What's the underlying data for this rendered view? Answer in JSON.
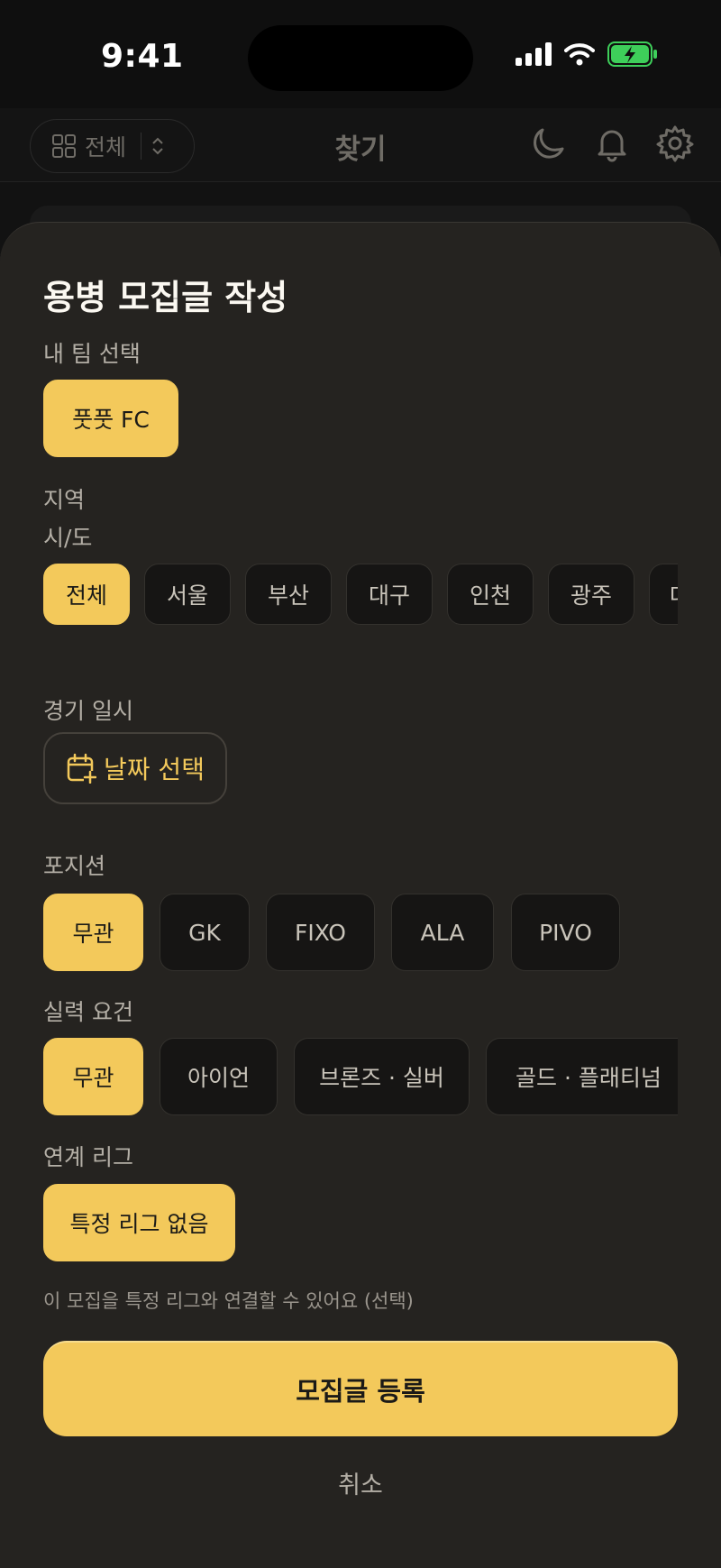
{
  "status_bar": {
    "time": "9:41"
  },
  "header": {
    "filter_label": "전체",
    "title": "찾기"
  },
  "sheet": {
    "title": "용병 모집글 작성",
    "team_section": {
      "label": "내 팀 선택",
      "selected_team": "풋풋 FC"
    },
    "region_section": {
      "label": "지역",
      "sublabel": "시/도",
      "options": [
        "전체",
        "서울",
        "부산",
        "대구",
        "인천",
        "광주",
        "대"
      ],
      "selected": "전체"
    },
    "date_section": {
      "label": "경기 일시",
      "button_label": "날짜 선택"
    },
    "position_section": {
      "label": "포지션",
      "options": [
        "무관",
        "GK",
        "FIXO",
        "ALA",
        "PIVO"
      ],
      "selected": "무관"
    },
    "skill_section": {
      "label": "실력 요건",
      "options": [
        "무관",
        "아이언",
        "브론즈 · 실버",
        "골드 · 플래티넘"
      ],
      "selected": "무관"
    },
    "league_section": {
      "label": "연계 리그",
      "selected_league": "특정 리그 없음",
      "helper": "이 모집을 특정 리그와 연결할 수 있어요 (선택)"
    },
    "submit_label": "모집글 등록",
    "cancel_label": "취소"
  },
  "colors": {
    "accent": "#f3c95b",
    "sheet_bg": "#252320",
    "chip_bg": "#161514"
  },
  "icons": [
    "grid-icon",
    "updown-icon",
    "moon-icon",
    "bell-icon",
    "gear-icon",
    "calendar-plus-icon",
    "signal-icon",
    "wifi-icon",
    "battery-icon"
  ]
}
